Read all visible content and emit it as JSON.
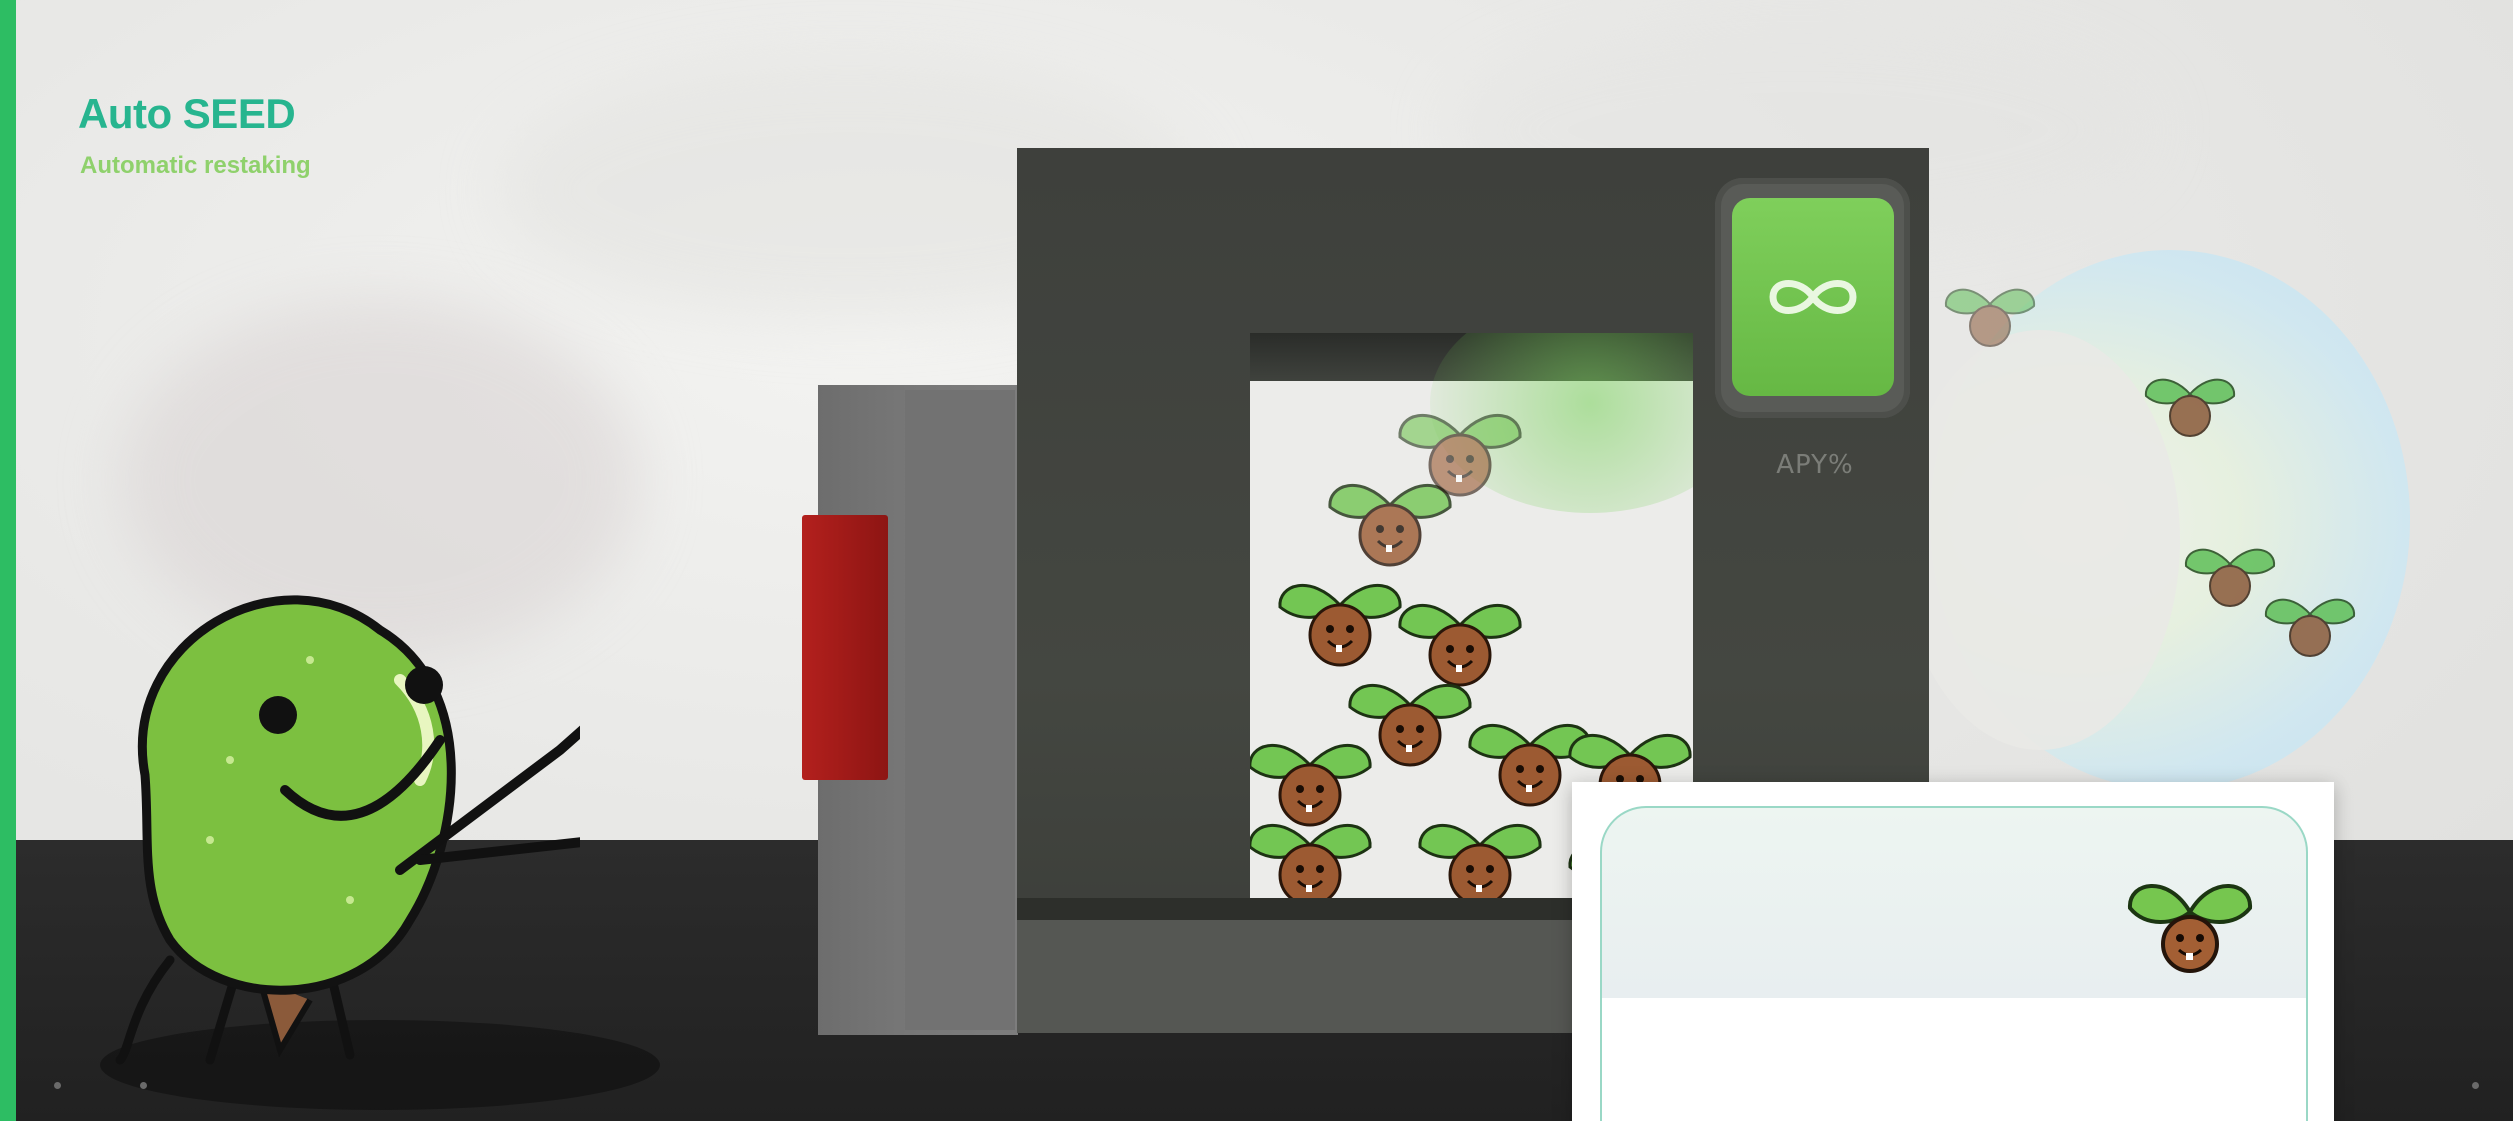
{
  "scene": {
    "accent_color": "#2dbd63",
    "floor_color": "#262626"
  },
  "machine": {
    "apy_label": "APY%",
    "apy_icon": "infinity-icon",
    "button_color": "#a51b18",
    "apy_color": "#72c44e"
  },
  "card": {
    "title": "Auto SEED",
    "subtitle": "Automatic restaking",
    "icon": "seed-sprout-icon",
    "title_color": "#27b58f",
    "subtitle_color": "#8fd16c"
  },
  "mascot": {
    "icon": "green-seed-mascot"
  }
}
